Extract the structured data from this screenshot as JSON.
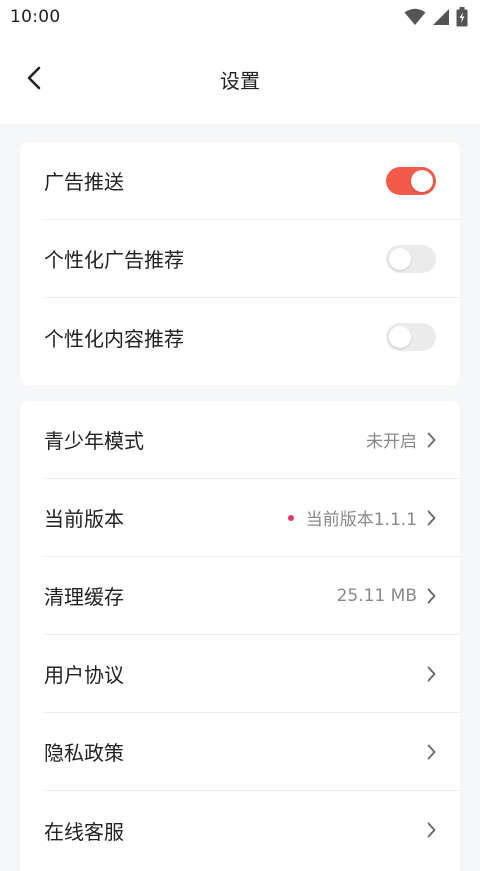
{
  "status_bar": {
    "time": "10:00"
  },
  "nav": {
    "title": "设置"
  },
  "ad_settings": [
    {
      "label": "广告推送",
      "enabled": true
    },
    {
      "label": "个性化广告推荐",
      "enabled": false
    },
    {
      "label": "个性化内容推荐",
      "enabled": false
    }
  ],
  "menu": [
    {
      "label": "青少年模式",
      "value": "未开启"
    },
    {
      "label": "当前版本",
      "value": "当前版本1.1.1"
    },
    {
      "label": "清理缓存",
      "value": "25.11 MB"
    },
    {
      "label": "用户协议",
      "value": ""
    },
    {
      "label": "隐私政策",
      "value": ""
    },
    {
      "label": "在线客服",
      "value": ""
    }
  ],
  "colors": {
    "accent": "#f25b4b",
    "badge_dot": "#e8336b"
  },
  "icons": [
    "wifi-icon",
    "signal-icon",
    "battery-icon",
    "back-arrow-icon",
    "chevron-right-icon"
  ]
}
